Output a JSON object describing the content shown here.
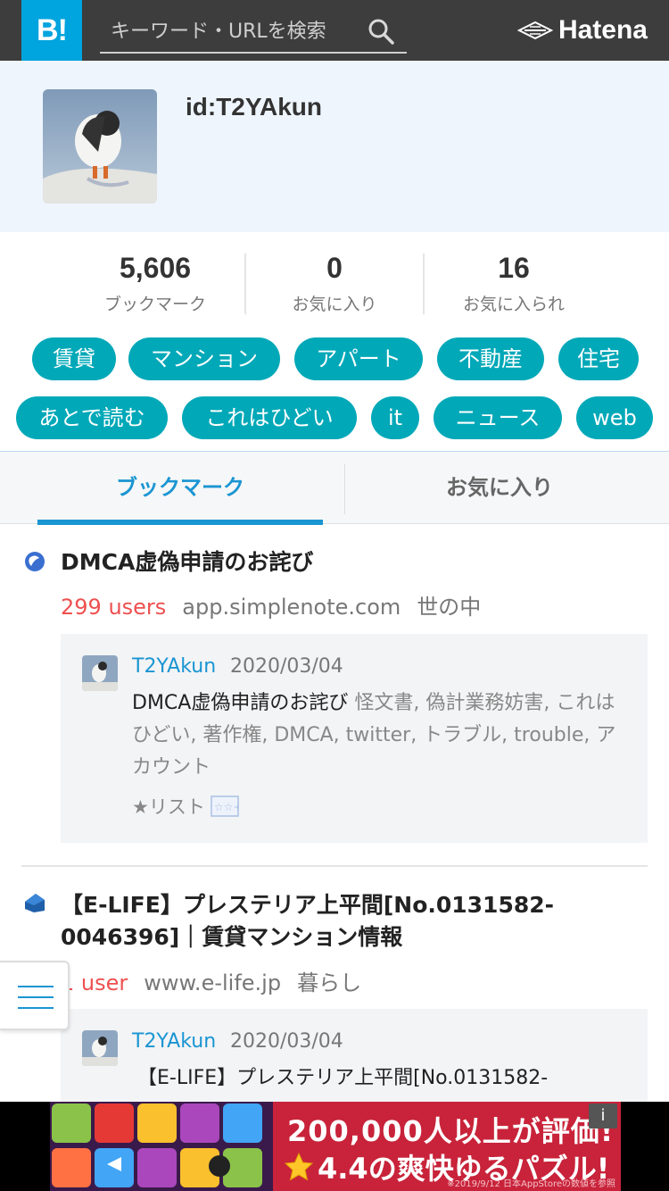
{
  "header": {
    "logo": "B!",
    "search_placeholder": "キーワード・URLを検索",
    "brand": "Hatena",
    "colors": {
      "logo_bg": "#00a4de",
      "bar_bg": "#3d3d3d"
    }
  },
  "profile": {
    "id": "id:T2YAkun"
  },
  "stats": [
    {
      "value": "5,606",
      "label": "ブックマーク"
    },
    {
      "value": "0",
      "label": "お気に入り"
    },
    {
      "value": "16",
      "label": "お気に入られ"
    }
  ],
  "tags": [
    "賃貸",
    "マンション",
    "アパート",
    "不動産",
    "住宅",
    "あとで読む",
    "これはひどい",
    "it",
    "ニュース",
    "web"
  ],
  "tabs": {
    "bookmarks": "ブックマーク",
    "favorites": "お気に入り"
  },
  "entries": [
    {
      "title": "DMCA虚偽申請のお詫び",
      "users": "299 users",
      "domain": "app.simplenote.com",
      "category": "世の中",
      "favicon": "simplenote-icon",
      "comment": {
        "user": "T2YAkun",
        "date": "2020/03/04",
        "text": "DMCA虚偽申請のお詫び",
        "tags": "怪文書, 偽計業務妨害, これはひどい, 著作権, DMCA, twitter, トラブル, trouble, アカウント",
        "list_label": "★リスト"
      }
    },
    {
      "title": "【E-LIFE】プレステリア上平間[No.0131582-0046396]｜賃貸マンション情報",
      "users": "1 user",
      "domain": "www.e-life.jp",
      "category": "暮らし",
      "favicon": "house-icon",
      "comment": {
        "user": "T2YAkun",
        "date": "2020/03/04",
        "text": "【E-LIFE】プレステリア上平間[No.0131582-"
      }
    }
  ],
  "ad": {
    "line1": "200,000人以上が評価!",
    "line2": "4.4の爽快ゆるパズル!",
    "note": "※2019/9/12 日本AppStoreの数値を参照",
    "info": "i"
  }
}
